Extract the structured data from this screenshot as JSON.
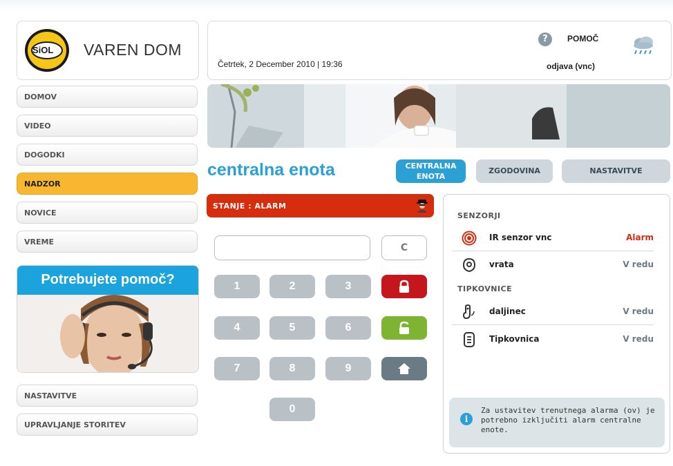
{
  "logo": {
    "mark_text": "SiOL",
    "app_name": "VAREN DOM"
  },
  "header": {
    "datetime": "Četrtek, 2 December 2010 | 19:36",
    "help_symbol": "?",
    "help_label": "POMOČ",
    "logout_label": "odjava (vnc)",
    "weather_icon": "cloud-rain-icon"
  },
  "nav": {
    "items": [
      {
        "label": "DOMOV"
      },
      {
        "label": "VIDEO"
      },
      {
        "label": "DOGODKI"
      },
      {
        "label": "NADZOR",
        "active": true
      },
      {
        "label": "NOVICE"
      },
      {
        "label": "VREME"
      }
    ],
    "bottom_items": [
      {
        "label": "NASTAVITVE"
      },
      {
        "label": "UPRAVLJANJE STORITEV"
      }
    ]
  },
  "help_banner": {
    "title": "Potrebujete pomoč?"
  },
  "page": {
    "title": "centralna enota"
  },
  "tabs": [
    {
      "label": "CENTRALNA ENOTA",
      "active": true
    },
    {
      "label": "ZGODOVINA"
    },
    {
      "label": "NASTAVITVE"
    }
  ],
  "status": {
    "text": "STANJE : ALARM",
    "icon": "burglar-icon"
  },
  "keypad": {
    "input_value": "",
    "clear_label": "C",
    "keys": [
      "1",
      "2",
      "3",
      "4",
      "5",
      "6",
      "7",
      "8",
      "9",
      "0"
    ],
    "actions": [
      "lock-icon",
      "unlock-icon",
      "home-icon"
    ]
  },
  "sensors": {
    "group_sensors": "SENZORJI",
    "group_keypads": "TIPKOVNICE",
    "items": [
      {
        "name": "IR senzor vnc",
        "state": "Alarm",
        "icon": "ir-sensor-icon"
      },
      {
        "name": "vrata",
        "state": "V redu",
        "icon": "door-sensor-icon"
      },
      {
        "name": "daljinec",
        "state": "V redu",
        "icon": "remote-icon"
      },
      {
        "name": "Tipkovnica",
        "state": "V redu",
        "icon": "keypad-icon"
      }
    ],
    "info_symbol": "i",
    "info_text": "Za ustavitev trenutnega alarma (ov) je potrebno izključiti alarm centralne enote."
  },
  "colors": {
    "accent": "#2aa0d4",
    "active_nav": "#f7b731",
    "alarm": "#d62d0e",
    "lock": "#c4161c",
    "unlock": "#7fb432"
  }
}
